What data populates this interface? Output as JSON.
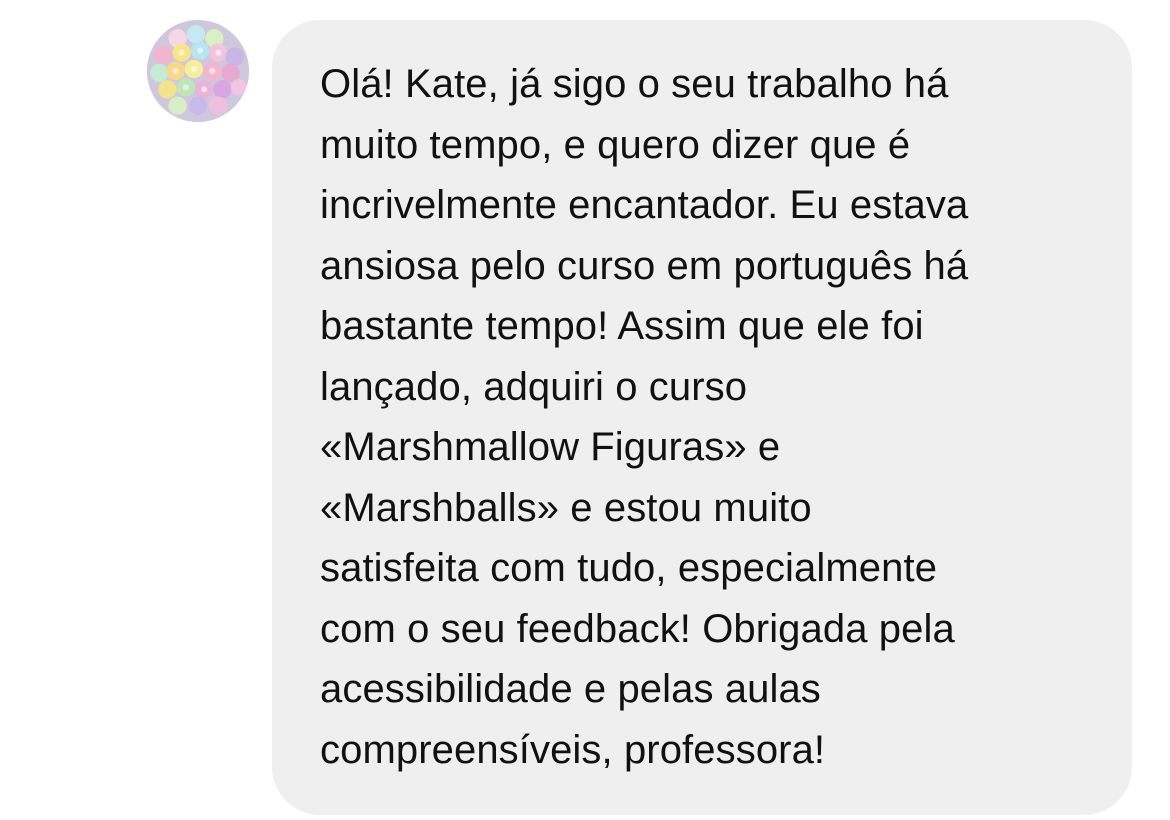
{
  "thread": {
    "incoming_message": {
      "sender": {
        "avatar_icon": "profile-photo-pastel-meringues"
      },
      "bubble_color": "#efefef",
      "text_color": "#111111",
      "text": "Olá! Kate, já sigo o seu trabalho há\nmuito tempo, e quero dizer que é\nincrivelmente encantador. Eu estava\nansiosa pelo curso em português há\nbastante tempo! Assim que ele foi\nlançado, adquiri o curso\n«Marshmallow Figuras» e\n«Marshballs» e estou muito\nsatisfeita com tudo, especialmente\ncom o seu feedback! Obrigada pela\nacessibilidade e pelas aulas\ncompreensíveis, professora!"
    }
  }
}
